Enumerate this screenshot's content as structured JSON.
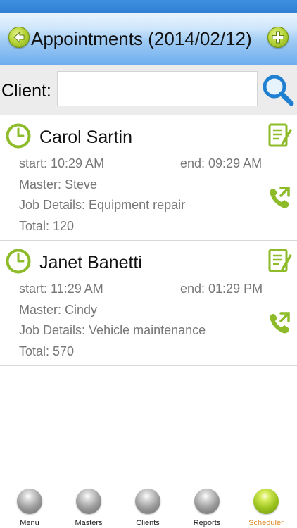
{
  "header": {
    "title": "Appointments (2014/02/12)",
    "back_icon": "arrow-left-icon",
    "add_icon": "plus-icon"
  },
  "search": {
    "label": "Client:",
    "value": "",
    "placeholder": "",
    "icon": "magnifier-icon"
  },
  "appointments": [
    {
      "name": "Carol Sartin",
      "start": "start: 10:29 AM",
      "end": "end: 09:29 AM",
      "master": "Master: Steve",
      "job": "Job Details: Equipment repair",
      "total": "Total: 120"
    },
    {
      "name": "Janet Banetti",
      "start": "start: 11:29 AM",
      "end": "end: 01:29 PM",
      "master": "Master: Cindy",
      "job": "Job Details: Vehicle maintenance",
      "total": "Total: 570"
    }
  ],
  "tabs": [
    {
      "label": "Menu",
      "active": false
    },
    {
      "label": "Masters",
      "active": false
    },
    {
      "label": "Clients",
      "active": false
    },
    {
      "label": "Reports",
      "active": false
    },
    {
      "label": "Scheduler",
      "active": true
    }
  ],
  "colors": {
    "accent_green": "#8dbb2a",
    "header_blue": "#6eaeee",
    "active_tab": "#e08a2a"
  }
}
